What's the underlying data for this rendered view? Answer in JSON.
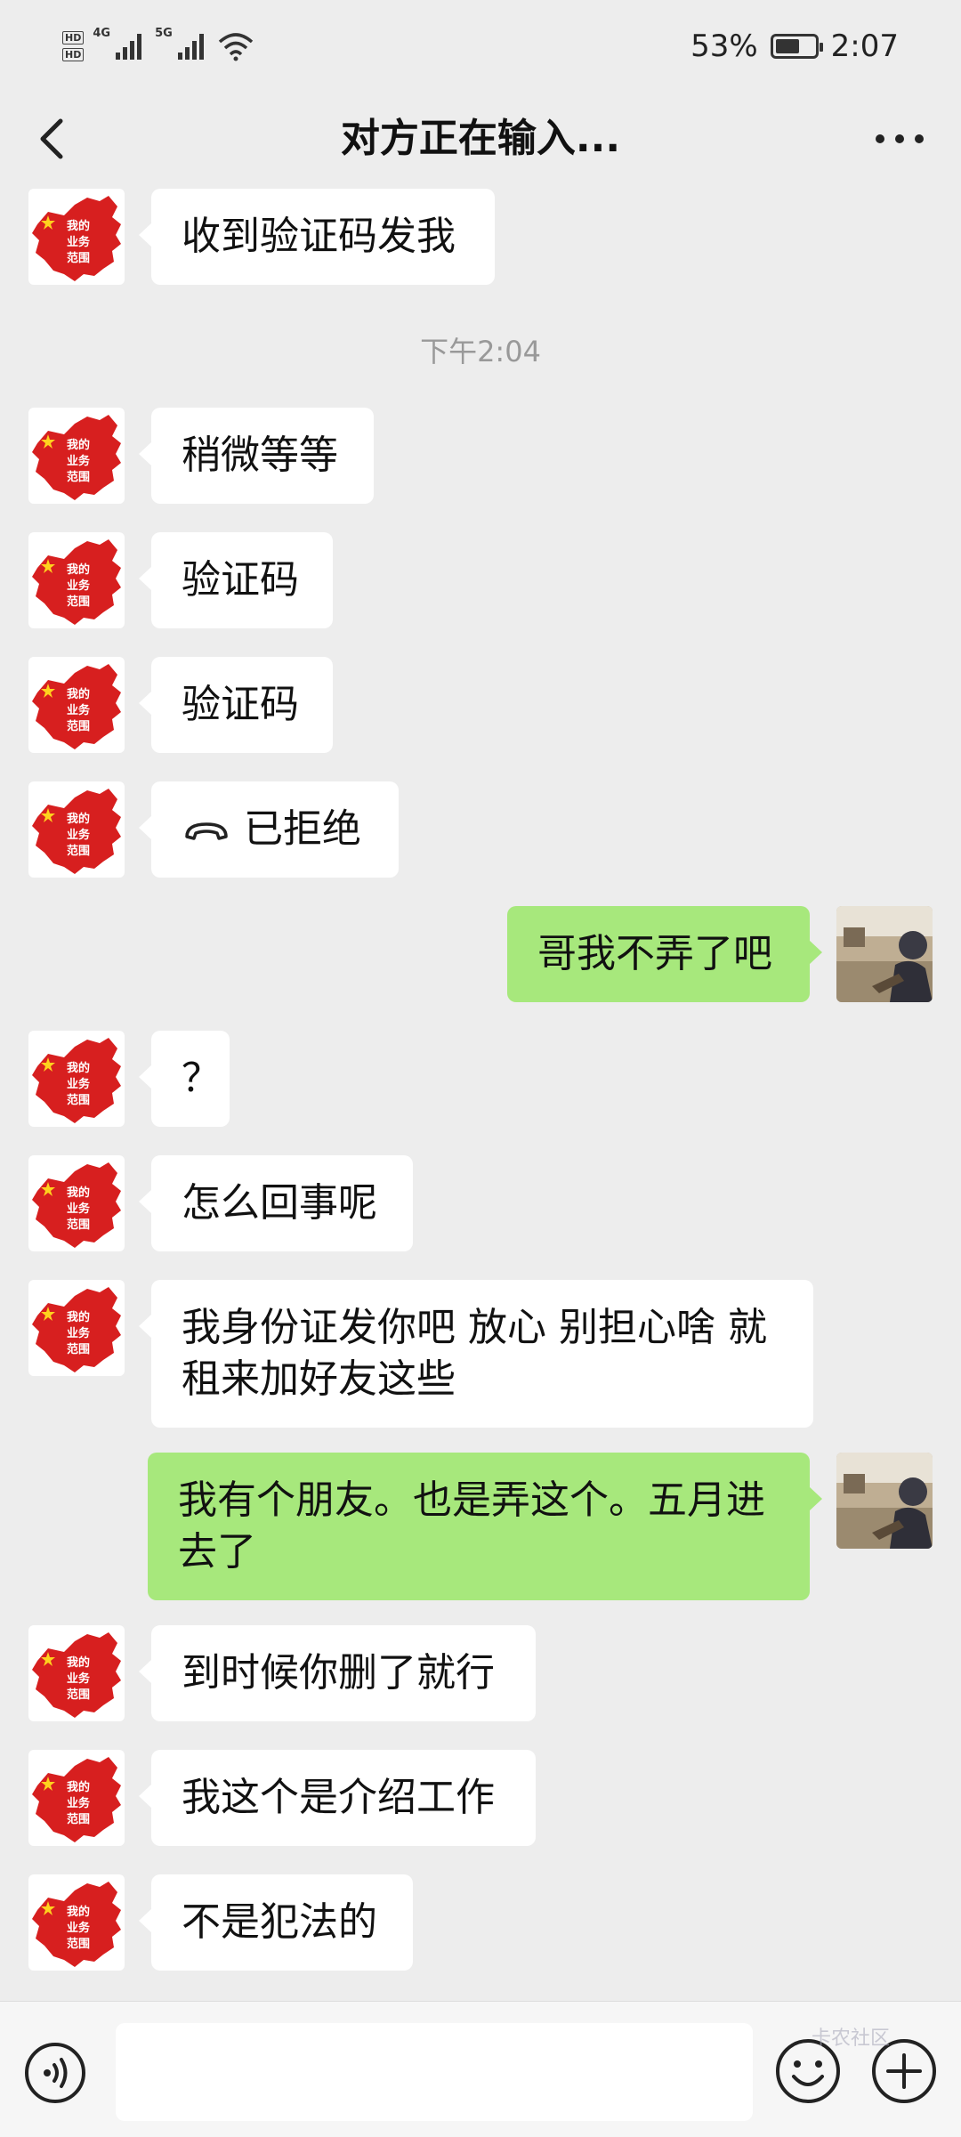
{
  "status_bar": {
    "battery": "53%",
    "time": "2:07",
    "hd1": "HD",
    "hd2": "HD",
    "net1": "4G",
    "net2": "5G"
  },
  "header": {
    "title": "对方正在输入..."
  },
  "timestamp": "下午2:04",
  "avatar_text": [
    "我的",
    "业务",
    "范围"
  ],
  "messages": [
    {
      "side": "left",
      "text": "收到验证码发我"
    },
    {
      "side": "left",
      "text": "稍微等等"
    },
    {
      "side": "left",
      "text": "验证码"
    },
    {
      "side": "left",
      "text": "验证码"
    },
    {
      "side": "left",
      "text": "已拒绝",
      "icon": "phone-hangup-icon"
    },
    {
      "side": "right",
      "text": "哥我不弄了吧"
    },
    {
      "side": "left",
      "text": "？"
    },
    {
      "side": "left",
      "text": "怎么回事呢"
    },
    {
      "side": "left",
      "text": "我身份证发你吧 放心 别担心啥 就租来加好友这些"
    },
    {
      "side": "right",
      "text": "我有个朋友。也是弄这个。五月进去了"
    },
    {
      "side": "left",
      "text": "到时候你删了就行"
    },
    {
      "side": "left",
      "text": "我这个是介绍工作"
    },
    {
      "side": "left",
      "text": "不是犯法的"
    }
  ],
  "colors": {
    "background": "#ededed",
    "my_bubble": "#a7e87c",
    "their_bubble": "#ffffff",
    "avatar_red": "#d71f1f"
  },
  "watermark": "卡农社区"
}
